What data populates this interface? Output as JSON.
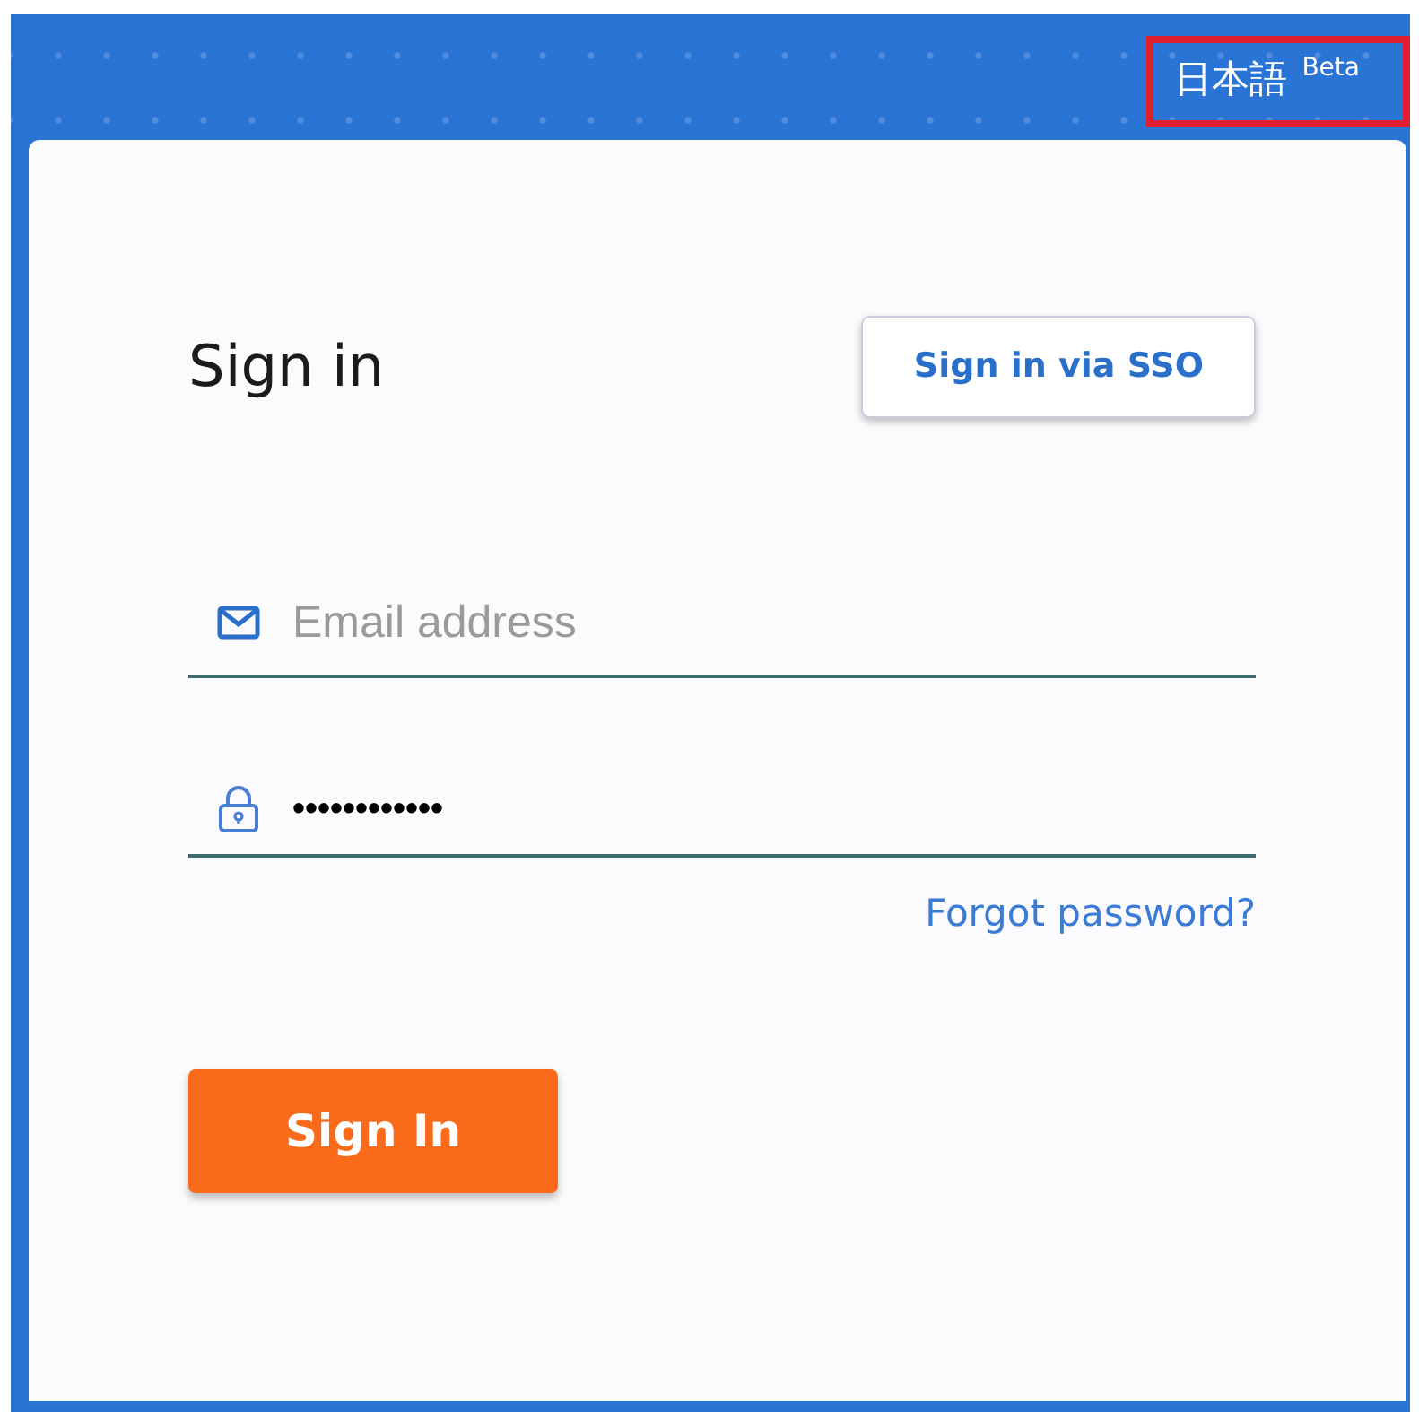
{
  "language": {
    "label": "日本語",
    "badge": "Beta",
    "highlighted": true
  },
  "title": "Sign in",
  "sso_button": "Sign in via SSO",
  "email": {
    "placeholder": "Email address"
  },
  "password": {
    "value": "••••••••••••"
  },
  "forgot_link": "Forgot password?",
  "submit_button": "Sign In"
}
